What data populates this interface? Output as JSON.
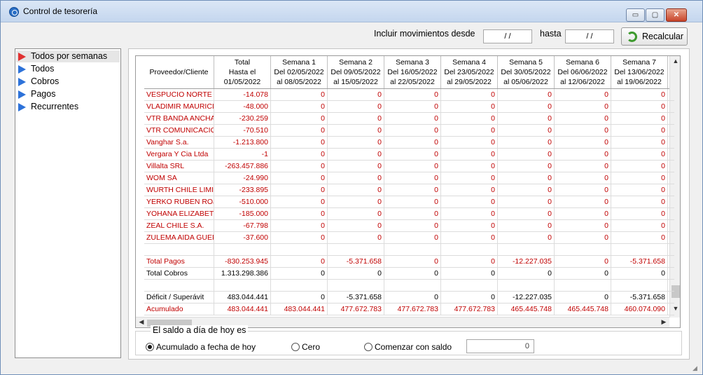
{
  "window": {
    "title": "Control de tesorería",
    "minimize": "▭",
    "maximize": "▢",
    "close": "✕"
  },
  "toolbar": {
    "incluir_label": "Incluir movimientos desde",
    "desde_value": "/ /",
    "hasta_label": "hasta",
    "hasta_value": "/ /",
    "recalcular_label": "Recalcular"
  },
  "nav": {
    "items": [
      {
        "label": "Todos por semanas",
        "selected": true
      },
      {
        "label": "Todos"
      },
      {
        "label": "Cobros"
      },
      {
        "label": "Pagos"
      },
      {
        "label": "Recurrentes"
      }
    ]
  },
  "grid": {
    "columns": [
      {
        "lines": [
          "Proveedor/Cliente"
        ]
      },
      {
        "lines": [
          "Total",
          "Hasta el",
          "01/05/2022"
        ]
      },
      {
        "lines": [
          "Semana 1",
          "Del 02/05/2022",
          "al 08/05/2022"
        ]
      },
      {
        "lines": [
          "Semana 2",
          "Del 09/05/2022",
          "al 15/05/2022"
        ]
      },
      {
        "lines": [
          "Semana 3",
          "Del 16/05/2022",
          "al 22/05/2022"
        ]
      },
      {
        "lines": [
          "Semana 4",
          "Del 23/05/2022",
          "al 29/05/2022"
        ]
      },
      {
        "lines": [
          "Semana 5",
          "Del 30/05/2022",
          "al 05/06/2022"
        ]
      },
      {
        "lines": [
          "Semana 6",
          "Del 06/06/2022",
          "al 12/06/2022"
        ]
      },
      {
        "lines": [
          "Semana 7",
          "Del 13/06/2022",
          "al 19/06/2022"
        ]
      }
    ],
    "rows": [
      {
        "color": "red",
        "cells": [
          "VESPUCIO NORTE E.",
          "-14.078",
          "0",
          "0",
          "0",
          "0",
          "0",
          "0",
          "0"
        ]
      },
      {
        "color": "red",
        "cells": [
          "VLADIMIR MAURICIO",
          "-48.000",
          "0",
          "0",
          "0",
          "0",
          "0",
          "0",
          "0"
        ]
      },
      {
        "color": "red",
        "cells": [
          "VTR BANDA ANCHA",
          "-230.259",
          "0",
          "0",
          "0",
          "0",
          "0",
          "0",
          "0"
        ]
      },
      {
        "color": "red",
        "cells": [
          "VTR COMUNICACION",
          "-70.510",
          "0",
          "0",
          "0",
          "0",
          "0",
          "0",
          "0"
        ]
      },
      {
        "color": "red",
        "cells": [
          "Vanghar S.a.",
          "-1.213.800",
          "0",
          "0",
          "0",
          "0",
          "0",
          "0",
          "0"
        ]
      },
      {
        "color": "red",
        "cells": [
          "Vergara Y Cia Ltda",
          "-1",
          "0",
          "0",
          "0",
          "0",
          "0",
          "0",
          "0"
        ]
      },
      {
        "color": "red",
        "cells": [
          "Villalta SRL",
          "-263.457.886",
          "0",
          "0",
          "0",
          "0",
          "0",
          "0",
          "0"
        ]
      },
      {
        "color": "red",
        "cells": [
          "WOM  SA",
          "-24.990",
          "0",
          "0",
          "0",
          "0",
          "0",
          "0",
          "0"
        ]
      },
      {
        "color": "red",
        "cells": [
          "WURTH CHILE LIMITA",
          "-233.895",
          "0",
          "0",
          "0",
          "0",
          "0",
          "0",
          "0"
        ]
      },
      {
        "color": "red",
        "cells": [
          "YERKO RUBEN ROJA",
          "-510.000",
          "0",
          "0",
          "0",
          "0",
          "0",
          "0",
          "0"
        ]
      },
      {
        "color": "red",
        "cells": [
          "YOHANA ELIZABET",
          "-185.000",
          "0",
          "0",
          "0",
          "0",
          "0",
          "0",
          "0"
        ]
      },
      {
        "color": "red",
        "cells": [
          "ZEAL CHILE S.A.",
          "-67.798",
          "0",
          "0",
          "0",
          "0",
          "0",
          "0",
          "0"
        ]
      },
      {
        "color": "red",
        "cells": [
          "ZULEMA AIDA GUEF",
          "-37.600",
          "0",
          "0",
          "0",
          "0",
          "0",
          "0",
          "0"
        ]
      },
      {
        "color": "blk",
        "cells": [
          "",
          "",
          "",
          "",
          "",
          "",
          "",
          "",
          ""
        ]
      },
      {
        "color": "red",
        "cells": [
          "Total Pagos",
          "-830.253.945",
          "0",
          "-5.371.658",
          "0",
          "0",
          "-12.227.035",
          "0",
          "-5.371.658"
        ]
      },
      {
        "color": "blk",
        "cells": [
          "Total Cobros",
          "1.313.298.386",
          "0",
          "0",
          "0",
          "0",
          "0",
          "0",
          "0"
        ]
      },
      {
        "color": "blk",
        "cells": [
          "",
          "",
          "",
          "",
          "",
          "",
          "",
          "",
          ""
        ]
      },
      {
        "color": "blk",
        "cells": [
          "Déficit / Superávit",
          "483.044.441",
          "0",
          "-5.371.658",
          "0",
          "0",
          "-12.227.035",
          "0",
          "-5.371.658"
        ]
      },
      {
        "color": "red",
        "cells": [
          "Acumulado",
          "483.044.441",
          "483.044.441",
          "477.672.783",
          "477.672.783",
          "477.672.783",
          "465.445.748",
          "465.445.748",
          "460.074.090"
        ]
      }
    ]
  },
  "saldo": {
    "title": "El saldo a día de hoy es",
    "opt1": "Acumulado a fecha de hoy",
    "opt2": "Cero",
    "opt3": "Comenzar con saldo",
    "saldo_value": "0"
  }
}
